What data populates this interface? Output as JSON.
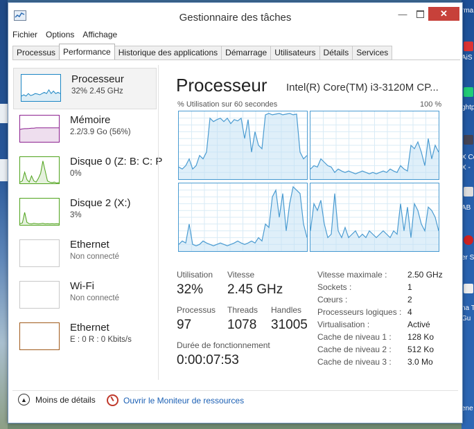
{
  "window": {
    "title": "Gestionnaire des tâches"
  },
  "menu": [
    "Fichier",
    "Options",
    "Affichage"
  ],
  "tabs": [
    {
      "label": "Processus",
      "active": false
    },
    {
      "label": "Performance",
      "active": true
    },
    {
      "label": "Historique des applications",
      "active": false
    },
    {
      "label": "Démarrage",
      "active": false
    },
    {
      "label": "Utilisateurs",
      "active": false
    },
    {
      "label": "Détails",
      "active": false
    },
    {
      "label": "Services",
      "active": false
    }
  ],
  "sidebar": [
    {
      "name": "Processeur",
      "detail": "32% 2.45 GHz",
      "color": "#1b86c4",
      "selected": true,
      "graph": [
        0.2,
        0.25,
        0.2,
        0.3,
        0.22,
        0.25,
        0.3,
        0.28,
        0.25,
        0.3,
        0.35,
        0.3,
        0.45,
        0.3,
        0.4,
        0.3,
        0.35,
        0.3
      ]
    },
    {
      "name": "Mémoire",
      "detail": "2.2/3.9 Go (56%)",
      "color": "#8b1f8f",
      "selected": false,
      "graph": [
        0.5,
        0.52,
        0.53,
        0.53,
        0.54,
        0.55,
        0.55,
        0.56,
        0.56,
        0.56,
        0.56,
        0.56,
        0.56,
        0.56,
        0.56,
        0.56,
        0.56,
        0.56
      ]
    },
    {
      "name": "Disque 0 (Z: B: C: P",
      "detail": "0%",
      "color": "#4ea21a",
      "selected": false,
      "graph": [
        0.05,
        0.1,
        0.45,
        0.15,
        0.05,
        0.3,
        0.1,
        0.05,
        0.2,
        0.4,
        0.9,
        0.5,
        0.1,
        0.05,
        0.03,
        0.05,
        0.02,
        0.03
      ]
    },
    {
      "name": "Disque 2 (X:)",
      "detail": "3%",
      "color": "#4ea21a",
      "selected": false,
      "graph": [
        0.05,
        0.08,
        0.5,
        0.1,
        0.05,
        0.04,
        0.06,
        0.05,
        0.04,
        0.05,
        0.06,
        0.04,
        0.05,
        0.04,
        0.05,
        0.04,
        0.05,
        0.04
      ]
    },
    {
      "name": "Ethernet",
      "detail": "Non connecté",
      "color": "#c8c8c8",
      "selected": false,
      "graph": []
    },
    {
      "name": "Wi-Fi",
      "detail": "Non connecté",
      "color": "#c8c8c8",
      "selected": false,
      "graph": []
    },
    {
      "name": "Ethernet",
      "detail": "E : 0 R : 0 Kbits/s",
      "color": "#a05a1a",
      "selected": false,
      "graph": []
    }
  ],
  "main": {
    "title": "Processeur",
    "model": "Intel(R) Core(TM) i3-3120M CP...",
    "graph_label": "% Utilisation sur 60 secondes",
    "graph_max": "100 %",
    "accent": "#4a9bd1"
  },
  "cores": [
    [
      0.18,
      0.15,
      0.2,
      0.3,
      0.15,
      0.2,
      0.35,
      0.3,
      0.4,
      0.9,
      0.85,
      0.88,
      0.9,
      0.85,
      0.9,
      0.82,
      0.88,
      0.86,
      0.9,
      0.6,
      0.88,
      0.4,
      0.7,
      0.5,
      0.45,
      0.95,
      0.97,
      0.95,
      0.96,
      0.97,
      0.95,
      0.96,
      0.97,
      0.95,
      0.96,
      0.4,
      0.3,
      0.35
    ],
    [
      0.15,
      0.2,
      0.18,
      0.3,
      0.25,
      0.2,
      0.18,
      0.1,
      0.15,
      0.12,
      0.1,
      0.12,
      0.1,
      0.08,
      0.1,
      0.12,
      0.1,
      0.08,
      0.1,
      0.08,
      0.1,
      0.12,
      0.1,
      0.15,
      0.12,
      0.1,
      0.2,
      0.15,
      0.12,
      0.5,
      0.45,
      0.55,
      0.4,
      0.2,
      0.6,
      0.3,
      0.5,
      0.4
    ],
    [
      0.1,
      0.15,
      0.12,
      0.4,
      0.1,
      0.08,
      0.1,
      0.15,
      0.12,
      0.1,
      0.08,
      0.1,
      0.12,
      0.1,
      0.08,
      0.1,
      0.12,
      0.15,
      0.12,
      0.1,
      0.12,
      0.15,
      0.12,
      0.2,
      0.15,
      0.4,
      0.35,
      0.8,
      0.9,
      0.5,
      0.85,
      0.3,
      0.7,
      0.95,
      0.9,
      0.85,
      0.4,
      0.2
    ],
    [
      0.3,
      0.7,
      0.6,
      0.75,
      0.4,
      0.2,
      0.25,
      0.85,
      0.3,
      0.2,
      0.35,
      0.2,
      0.25,
      0.3,
      0.2,
      0.25,
      0.2,
      0.3,
      0.25,
      0.2,
      0.25,
      0.3,
      0.25,
      0.2,
      0.3,
      0.25,
      0.7,
      0.3,
      0.65,
      0.2,
      0.7,
      0.6,
      0.4,
      0.3,
      0.65,
      0.6,
      0.5,
      0.3
    ]
  ],
  "stats": {
    "utilisation_label": "Utilisation",
    "utilisation": "32%",
    "vitesse_label": "Vitesse",
    "vitesse": "2.45 GHz",
    "processus_label": "Processus",
    "processus": "97",
    "threads_label": "Threads",
    "threads": "1078",
    "handles_label": "Handles",
    "handles": "31005",
    "uptime_label": "Durée de fonctionnement",
    "uptime": "0:00:07:53"
  },
  "specs": [
    {
      "label": "Vitesse maximale :",
      "value": "2.50 GHz"
    },
    {
      "label": "Sockets :",
      "value": "1"
    },
    {
      "label": "Cœurs :",
      "value": "2"
    },
    {
      "label": "Processeurs logiques :",
      "value": "4"
    },
    {
      "label": "Virtualisation :",
      "value": "Activé"
    },
    {
      "label": "Cache de niveau 1 :",
      "value": "128 Ko"
    },
    {
      "label": "Cache de niveau 2 :",
      "value": "512 Ko"
    },
    {
      "label": "Cache de niveau 3 :",
      "value": "3.0 Mo"
    }
  ],
  "footer": {
    "less_details": "Moins de détails",
    "resmon": "Ouvrir le Moniteur de ressources"
  },
  "desktop": {
    "right_labels": [
      "rma",
      "AiS",
      "ghtp",
      "X Ce",
      "X -",
      "AB",
      "er S",
      "na T",
      "Gu",
      "ene"
    ]
  }
}
